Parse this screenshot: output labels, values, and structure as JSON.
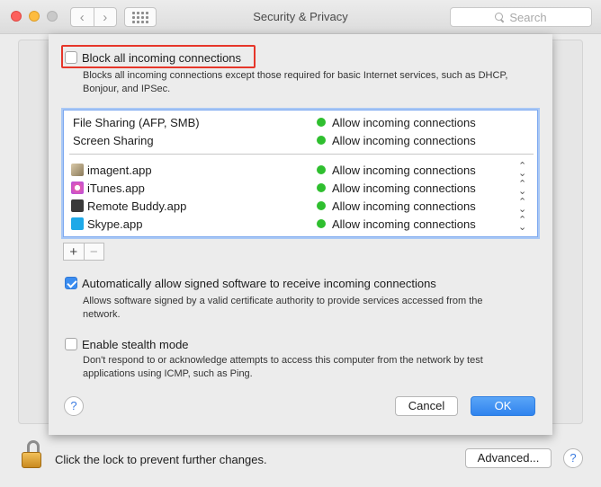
{
  "window": {
    "title": "Security & Privacy"
  },
  "toolbar": {
    "back_glyph": "‹",
    "forward_glyph": "›",
    "search_placeholder": "Search"
  },
  "icons": {
    "close": "close-icon",
    "minimize": "minimize-icon",
    "maximize": "maximize-icon",
    "back": "chevron-left-icon",
    "forward": "chevron-right-icon",
    "grid": "grid-icon",
    "search": "search-icon",
    "lock": "lock-open-icon",
    "help": "help-icon"
  },
  "colors": {
    "accent": "#3b8df0",
    "status_green": "#2fbf2f",
    "highlight_red": "#e6362a"
  },
  "sheet": {
    "block_all": {
      "label": "Block all incoming connections",
      "checked": false,
      "description": "Blocks all incoming connections except those required for basic Internet services,  such as DHCP, Bonjour, and IPSec."
    },
    "services": [
      {
        "name": "File Sharing (AFP, SMB)",
        "status": "Allow incoming connections"
      },
      {
        "name": "Screen Sharing",
        "status": "Allow incoming connections"
      }
    ],
    "apps": [
      {
        "name": "imagent.app",
        "status": "Allow incoming connections",
        "icon": "imagent-app-icon"
      },
      {
        "name": "iTunes.app",
        "status": "Allow incoming connections",
        "icon": "itunes-app-icon"
      },
      {
        "name": "Remote Buddy.app",
        "status": "Allow incoming connections",
        "icon": "remote-buddy-app-icon"
      },
      {
        "name": "Skype.app",
        "status": "Allow incoming connections",
        "icon": "skype-app-icon"
      }
    ],
    "add_label": "+",
    "remove_label": "−",
    "stepper_glyph": "⌃⌄",
    "auto_allow": {
      "label": "Automatically allow signed software to receive incoming connections",
      "checked": true,
      "description_line1": "Allows software signed by a valid certificate authority to provide services accessed from the",
      "description_line2": "network."
    },
    "stealth": {
      "label": "Enable stealth mode",
      "checked": false,
      "description_line1": "Don't respond to or acknowledge attempts to access this computer from the network by test",
      "description_line2": "applications using ICMP, such as Ping."
    },
    "help_label": "?",
    "cancel_label": "Cancel",
    "ok_label": "OK"
  },
  "footer": {
    "lock_text": "Click the lock to prevent further changes.",
    "advanced_label": "Advanced...",
    "help_label": "?"
  }
}
